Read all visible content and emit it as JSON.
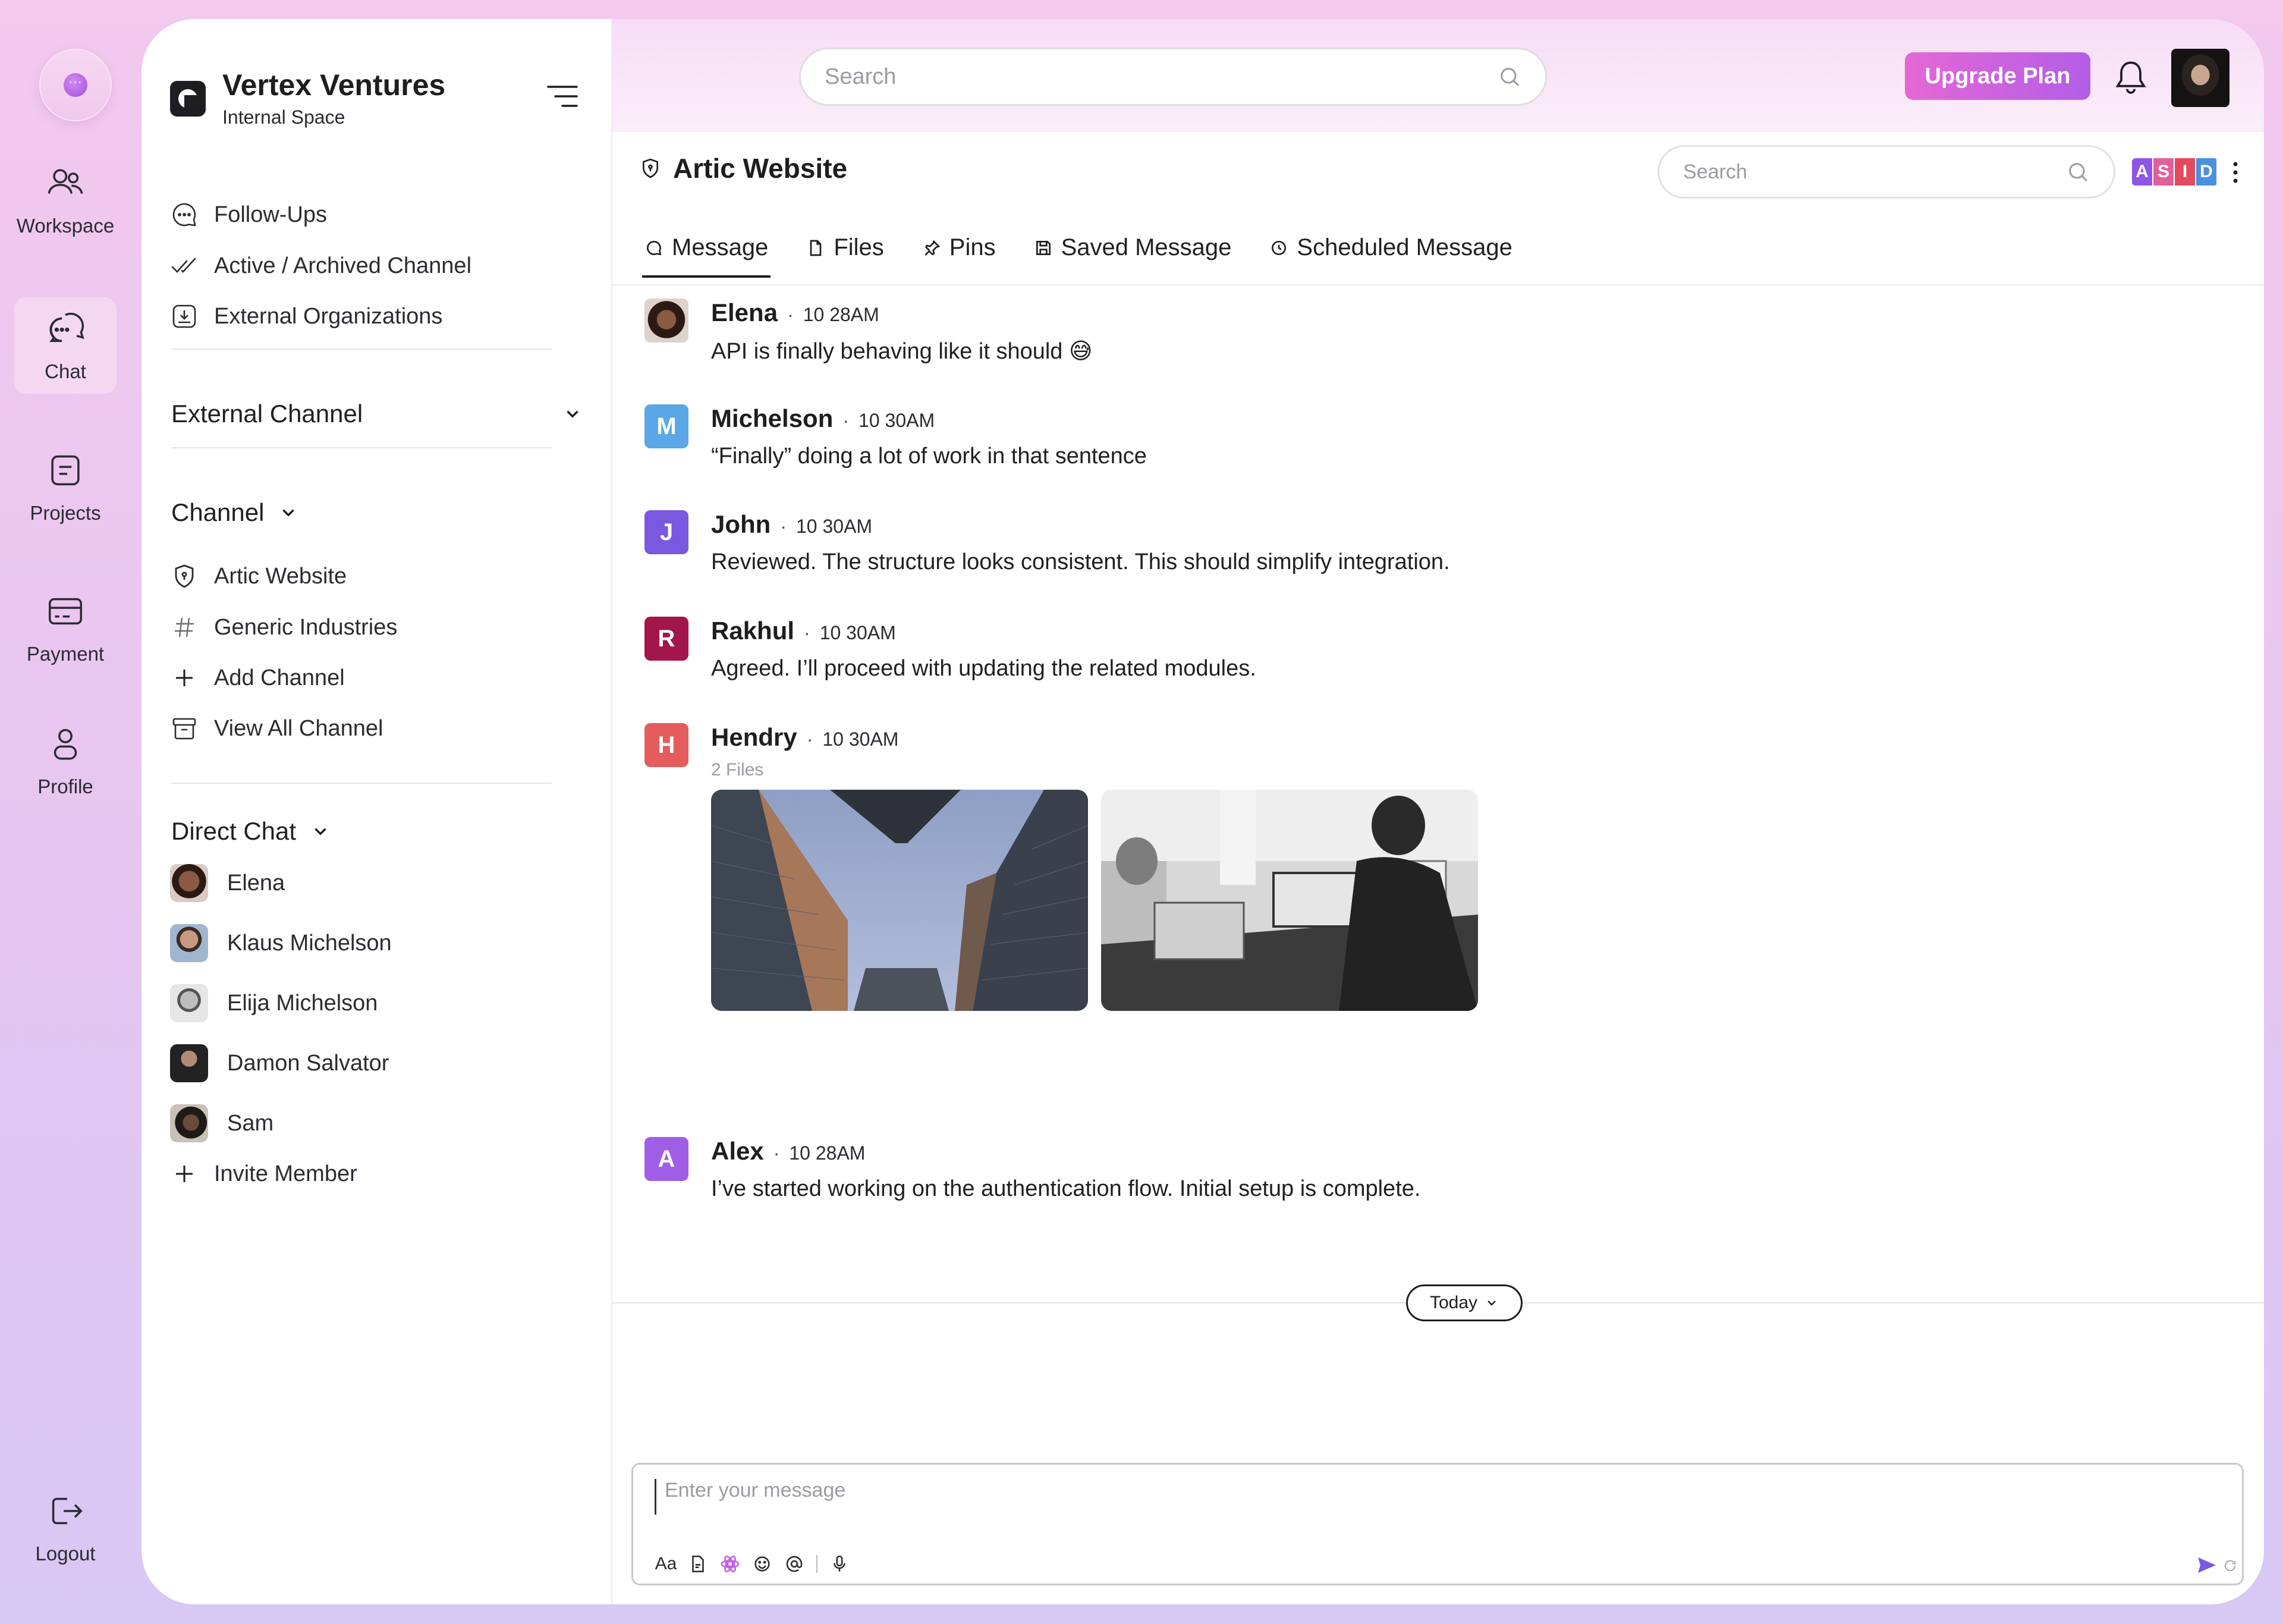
{
  "rail": {
    "items": [
      {
        "label": "Workspace",
        "icon": "users-icon"
      },
      {
        "label": "Chat",
        "icon": "chat-icon",
        "active": true
      },
      {
        "label": "Projects",
        "icon": "projects-icon"
      },
      {
        "label": "Payment",
        "icon": "payment-icon"
      },
      {
        "label": "Profile",
        "icon": "profile-icon"
      }
    ],
    "logout": "Logout"
  },
  "sidebar": {
    "brand_title": "Vertex Ventures",
    "brand_sub": "Internal Space",
    "quick_links": [
      {
        "label": "Follow-Ups",
        "icon": "chat-bubble-icon"
      },
      {
        "label": "Active / Archived Channel",
        "icon": "double-check-icon"
      },
      {
        "label": "External Organizations",
        "icon": "inbox-download-icon"
      }
    ],
    "external_channel": "External Channel",
    "channel_section": "Channel",
    "channels": [
      {
        "label": "Artic Website",
        "icon": "shield-icon"
      },
      {
        "label": "Generic Industries",
        "icon": "hash-icon"
      },
      {
        "label": "Add Channel",
        "icon": "plus-icon"
      },
      {
        "label": "View All Channel",
        "icon": "archive-icon"
      }
    ],
    "direct_section": "Direct Chat",
    "direct": [
      {
        "label": "Elena"
      },
      {
        "label": "Klaus Michelson"
      },
      {
        "label": "Elija Michelson"
      },
      {
        "label": "Damon Salvator"
      },
      {
        "label": "Sam"
      }
    ],
    "invite": "Invite Member"
  },
  "topbar": {
    "search_placeholder": "Search",
    "upgrade_label": "Upgrade Plan"
  },
  "channel": {
    "title": "Artic Website",
    "search_placeholder": "Search",
    "members": [
      {
        "initial": "A",
        "color": "#8f55e6"
      },
      {
        "initial": "S",
        "color": "#e0609a"
      },
      {
        "initial": "I",
        "color": "#e24b5b"
      },
      {
        "initial": "D",
        "color": "#4a90e2"
      }
    ],
    "tabs": [
      {
        "label": "Message",
        "icon": "message-icon"
      },
      {
        "label": "Files",
        "icon": "file-icon"
      },
      {
        "label": "Pins",
        "icon": "pin-icon"
      },
      {
        "label": "Saved Message",
        "icon": "save-icon"
      },
      {
        "label": "Scheduled Message",
        "icon": "clock-icon"
      }
    ]
  },
  "messages": [
    {
      "name": "Elena",
      "time": "10 28AM",
      "text": "API is finally behaving like it should 😅",
      "initial": "",
      "color": "#6b4a3a"
    },
    {
      "name": "Michelson",
      "time": "10 30AM",
      "text": "“Finally” doing a lot of work in that sentence",
      "initial": "M",
      "color": "#5aa6e6"
    },
    {
      "name": "John",
      "time": "10 30AM",
      "text": "Reviewed. The structure looks consistent. This should simplify integration.",
      "initial": "J",
      "color": "#7a58e0"
    },
    {
      "name": "Rakhul",
      "time": "10 30AM",
      "text": "Agreed. I’ll proceed with updating the related modules.",
      "initial": "R",
      "color": "#a3164a"
    },
    {
      "name": "Hendry",
      "time": "10 30AM",
      "files_count": "2 Files",
      "initial": "H",
      "color": "#e45d5d"
    },
    {
      "name": "Alex",
      "time": "10 28AM",
      "text": "I’ve started working on the authentication flow. Initial setup is complete.",
      "initial": "A",
      "color": "#a05ee6"
    }
  ],
  "separator": {
    "label": "Today"
  },
  "composer": {
    "placeholder": "Enter your message",
    "format_label": "Aa"
  }
}
